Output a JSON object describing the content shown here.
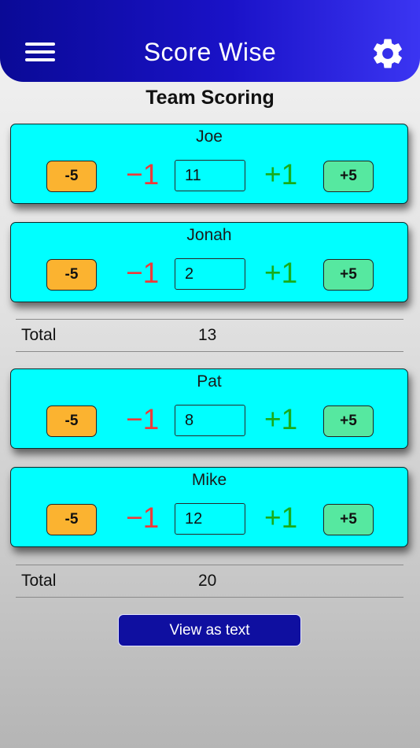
{
  "header": {
    "title": "Score Wise",
    "menu_icon": "hamburger-menu-icon",
    "settings_icon": "gear-icon"
  },
  "page": {
    "title": "Team Scoring"
  },
  "controls": {
    "minus5": "-5",
    "minus1": "−1",
    "plus1": "+1",
    "plus5": "+5"
  },
  "teams": [
    {
      "players": [
        {
          "name": "Joe",
          "score": "11"
        },
        {
          "name": "Jonah",
          "score": "2"
        }
      ],
      "total_label": "Total",
      "total": "13"
    },
    {
      "players": [
        {
          "name": "Pat",
          "score": "8"
        },
        {
          "name": "Mike",
          "score": "12"
        }
      ],
      "total_label": "Total",
      "total": "20"
    }
  ],
  "footer": {
    "view_as_text_label": "View as text"
  },
  "colors": {
    "header_start": "#0a0a96",
    "header_end": "#3b35f2",
    "card_bg": "#00ffff",
    "minus5_bg": "#fbb330",
    "plus5_bg": "#56e8a0",
    "minus1_text": "#ee3a3a",
    "plus1_text": "#19ab19",
    "view_button_bg": "#0f0fa0"
  }
}
